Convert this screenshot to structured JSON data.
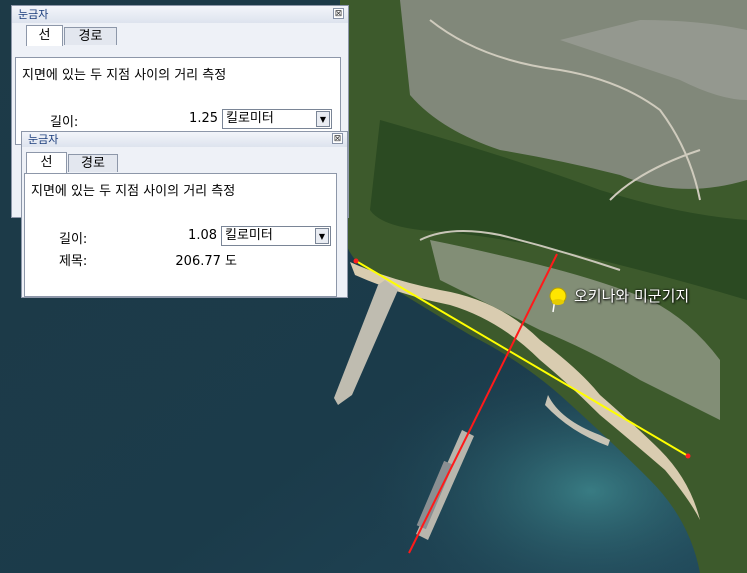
{
  "map": {
    "place_label": "오키나와 미군기지"
  },
  "ruler_back": {
    "title": "눈금자",
    "close": "⊠",
    "tabs": [
      "선",
      "경로"
    ],
    "description": "지면에 있는 두 지점 사이의 거리 측정",
    "length_label": "길이:",
    "length_value": "1.25",
    "unit": "킬로미터"
  },
  "ruler_front": {
    "title": "눈금자",
    "close": "⊠",
    "tabs": [
      "선",
      "경로"
    ],
    "description": "지면에 있는 두 지점 사이의 거리 측정",
    "length_label": "길이:",
    "length_value": "1.08",
    "unit": "킬로미터",
    "heading_label": "제목:",
    "heading_value": "206.77 도"
  },
  "colors": {
    "measure_line_yellow": "#ffff00",
    "measure_line_red": "#ff1a1a",
    "pin": "#ffe600"
  }
}
